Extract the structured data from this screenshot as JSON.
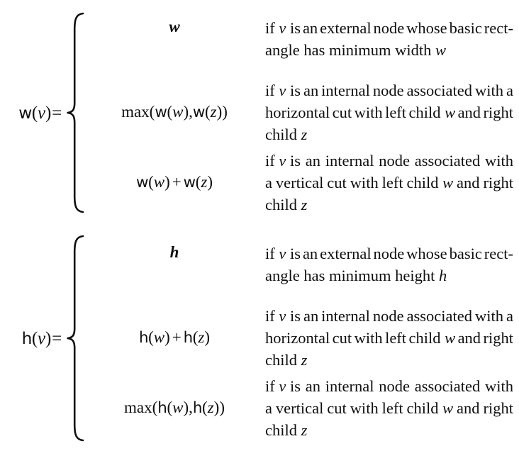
{
  "document": {
    "type": "mathematical-formula-figure",
    "background_color": "#ffffff",
    "text_color": "#100f0f",
    "equation_count": 2
  },
  "equations": [
    {
      "id": "width-recurrence",
      "lhs": {
        "fn": "w",
        "open": "(",
        "arg": "v",
        "close": ")",
        "equals": "="
      },
      "cases": [
        {
          "formula_parts": {
            "plain": "w"
          },
          "formula_text": "w",
          "description_text": "if v is an external node whose basic rectangle has minimum width w",
          "description_lines": [
            {
              "words": [
                "if",
                "v",
                "is",
                "an",
                "external",
                "node",
                "whose",
                "basic",
                "rect-"
              ],
              "justify": true
            },
            {
              "words": [
                "angle",
                "has",
                "minimum",
                "width",
                "w"
              ],
              "justify": false
            }
          ]
        },
        {
          "formula_text": "max(w(w),w(z))",
          "description_text": "if v is an internal node associated with a horizontal cut with left child w and right child z",
          "description_lines": [
            {
              "words": [
                "if",
                "v",
                "is",
                "an",
                "internal",
                "node",
                "associated",
                "with",
                "a"
              ],
              "justify": true
            },
            {
              "words": [
                "horizontal",
                "cut",
                "with",
                "left",
                "child",
                "w",
                "and",
                "right"
              ],
              "justify": true
            },
            {
              "words": [
                "child",
                "z"
              ],
              "justify": false
            }
          ]
        },
        {
          "formula_text": "w(w) + w(z)",
          "description_text": "if v is an internal node associated with a vertical cut with left child w and right child z",
          "description_lines": [
            {
              "words": [
                "if",
                "v",
                "is",
                "an",
                "internal",
                "node",
                "associated",
                "with"
              ],
              "justify": true
            },
            {
              "words": [
                "a",
                "vertical",
                "cut",
                "with",
                "left",
                "child",
                "w",
                "and",
                "right"
              ],
              "justify": true
            },
            {
              "words": [
                "child",
                "z"
              ],
              "justify": false
            }
          ]
        }
      ]
    },
    {
      "id": "height-recurrence",
      "lhs": {
        "fn": "h",
        "open": "(",
        "arg": "v",
        "close": ")",
        "equals": "="
      },
      "cases": [
        {
          "formula_text": "h",
          "description_text": "if v is an external node whose basic rectangle has minimum height h",
          "description_lines": [
            {
              "words": [
                "if",
                "v",
                "is",
                "an",
                "external",
                "node",
                "whose",
                "basic",
                "rect-"
              ],
              "justify": true
            },
            {
              "words": [
                "angle",
                "has",
                "minimum",
                "height",
                "h"
              ],
              "justify": false
            }
          ]
        },
        {
          "formula_text": "h(w) + h(z)",
          "description_text": "if v is an internal node associated with a horizontal cut with left child w and right child z",
          "description_lines": [
            {
              "words": [
                "if",
                "v",
                "is",
                "an",
                "internal",
                "node",
                "associated",
                "with",
                "a"
              ],
              "justify": true
            },
            {
              "words": [
                "horizontal",
                "cut",
                "with",
                "left",
                "child",
                "w",
                "and",
                "right"
              ],
              "justify": true
            },
            {
              "words": [
                "child",
                "z"
              ],
              "justify": false
            }
          ]
        },
        {
          "formula_text": "max(h(w),h(z))",
          "description_text": "if v is an internal node associated with a vertical cut with left child w and right child z",
          "description_lines": [
            {
              "words": [
                "if",
                "v",
                "is",
                "an",
                "internal",
                "node",
                "associated",
                "with"
              ],
              "justify": true
            },
            {
              "words": [
                "a",
                "vertical",
                "cut",
                "with",
                "left",
                "child",
                "w",
                "and",
                "right"
              ],
              "justify": true
            },
            {
              "words": [
                "child",
                "z"
              ],
              "justify": false
            }
          ]
        }
      ]
    }
  ],
  "symbols": {
    "max_label": "max",
    "plus_operator": "+",
    "comma": ",",
    "left_paren": "(",
    "right_paren": ")",
    "equals": "=",
    "variable_v": "v",
    "variable_w": "w",
    "variable_z": "z",
    "function_w": "w",
    "function_h": "h",
    "brace": "{"
  }
}
